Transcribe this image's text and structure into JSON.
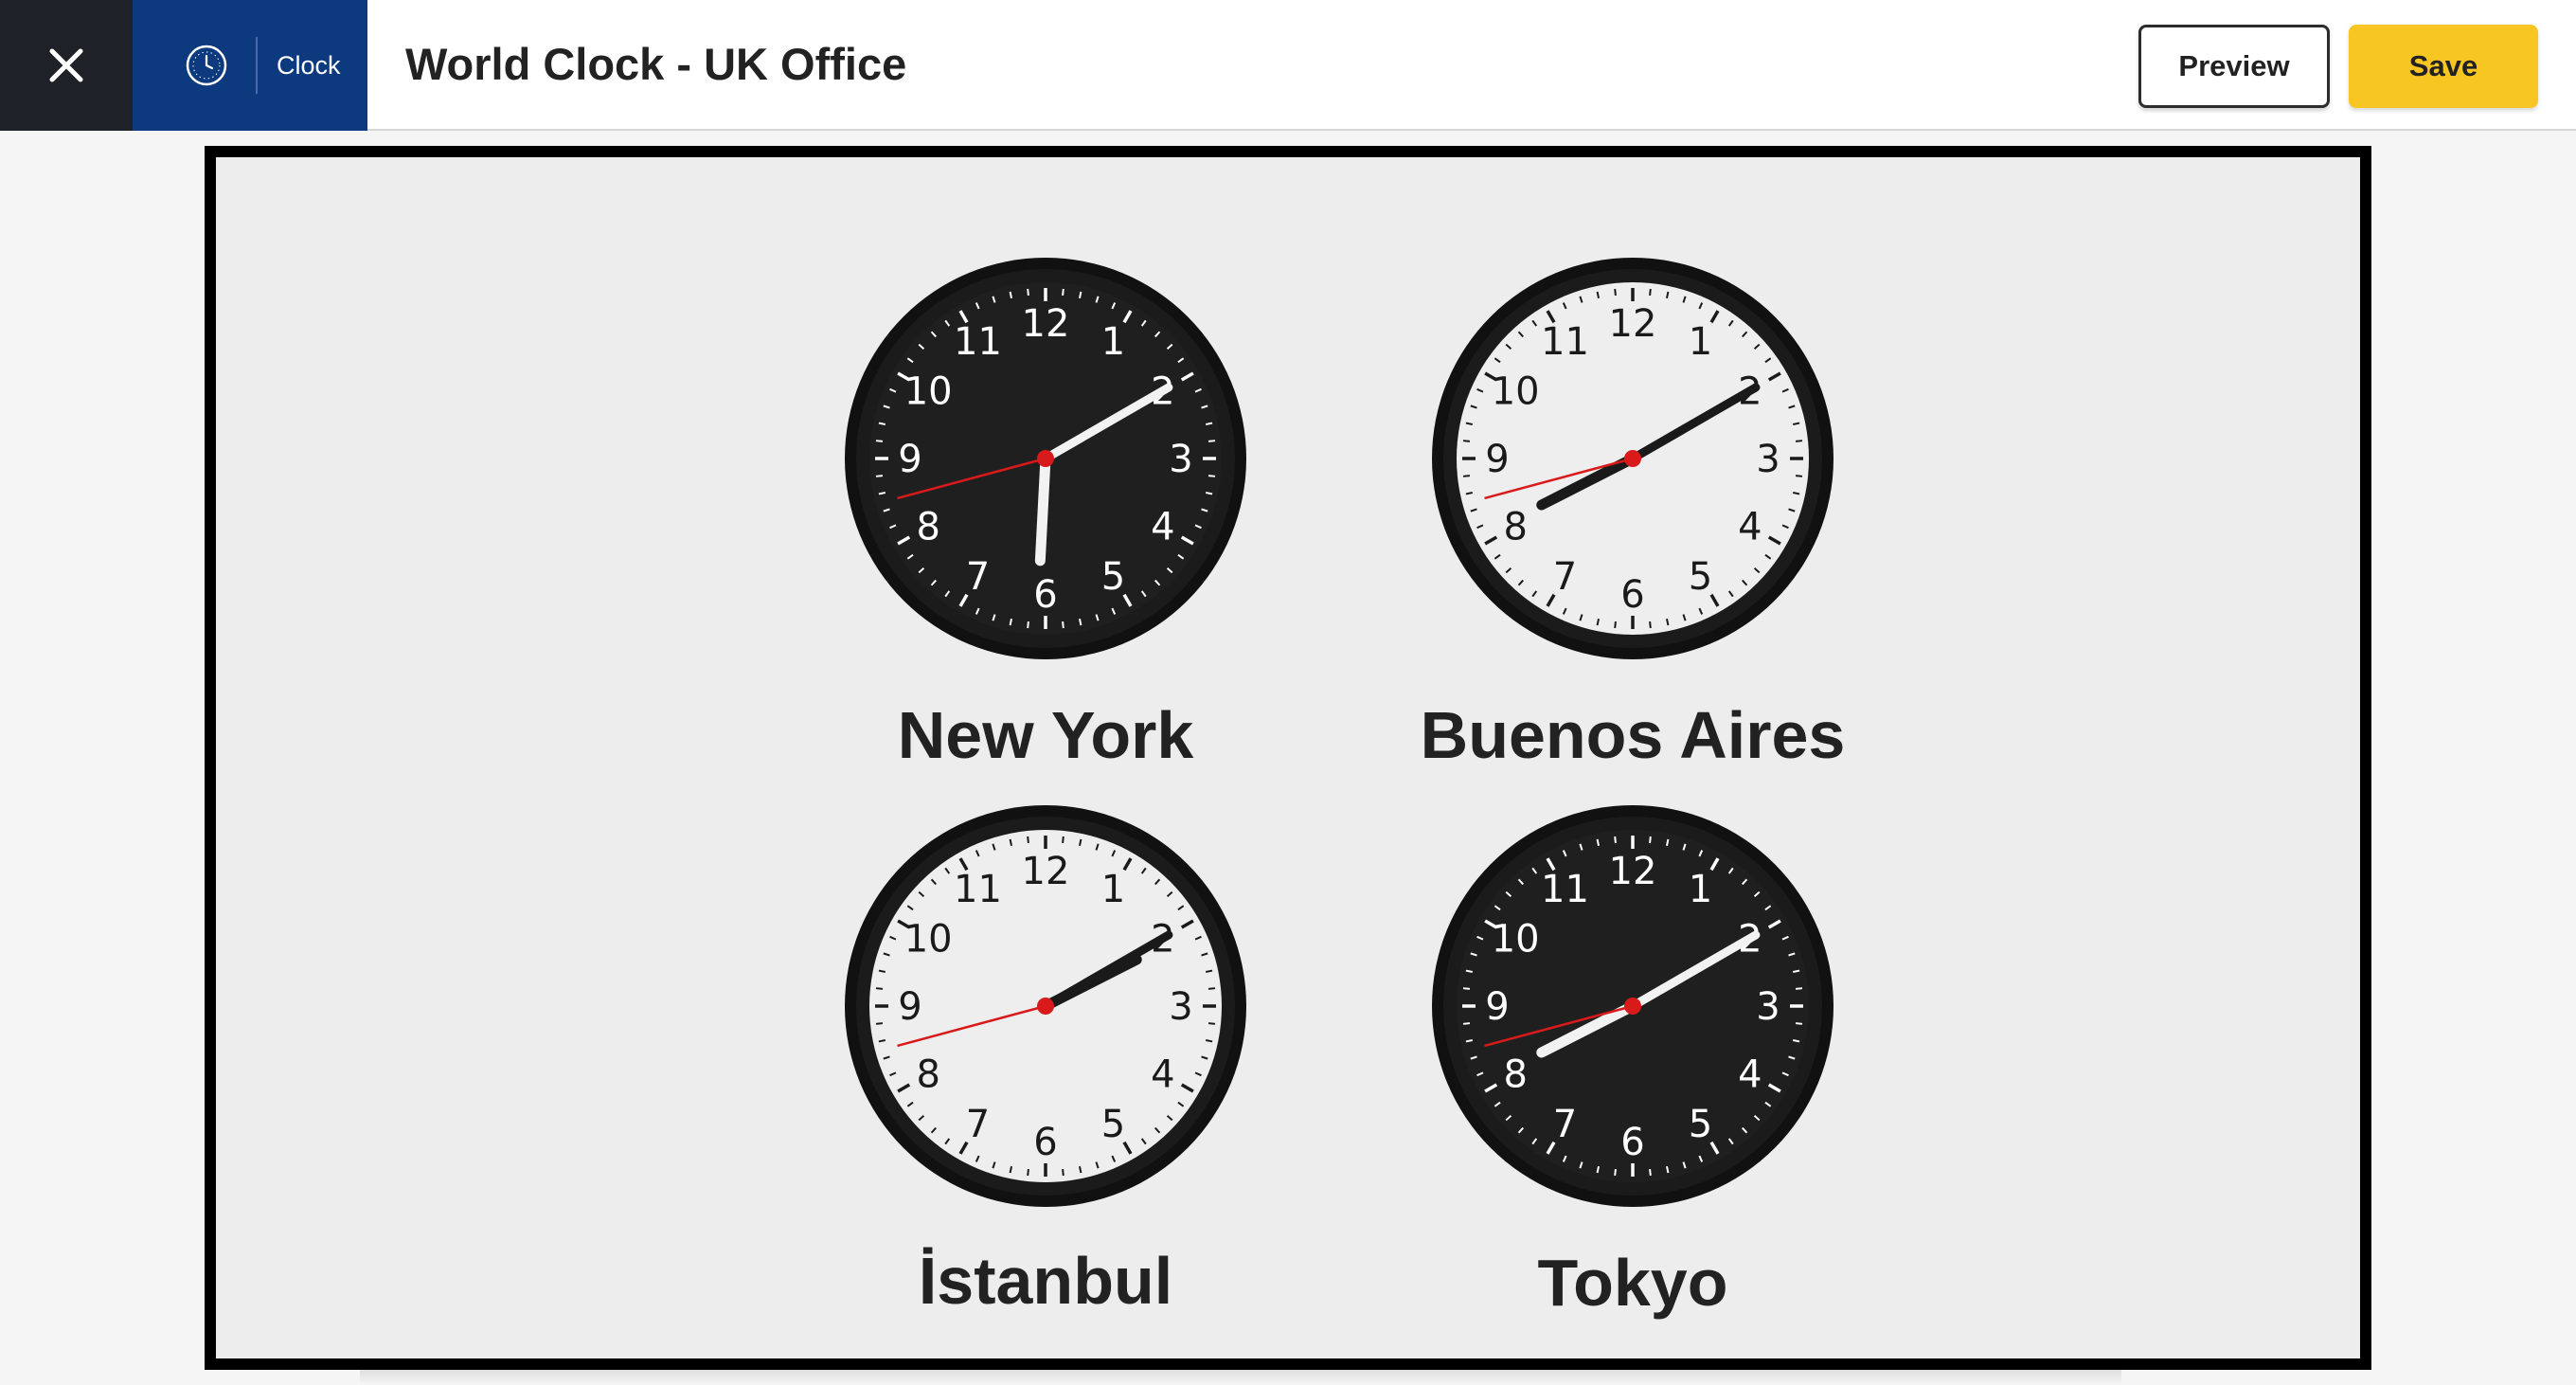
{
  "header": {
    "close_icon": "close-icon",
    "app_icon": "clock-icon",
    "app_label": "Clock",
    "title": "World Clock - UK Office",
    "preview_label": "Preview",
    "save_label": "Save",
    "colors": {
      "app_badge": "#0d3a7e",
      "save_button": "#f7c623",
      "close_area": "#1e2228"
    }
  },
  "clocks": [
    {
      "city": "New York",
      "theme": "dark",
      "hour_hand_clock_position": 6.1,
      "minute_hand_clock_position": 2.0,
      "second_hand_clock_position": 8.5
    },
    {
      "city": "Buenos Aires",
      "theme": "light",
      "hour_hand_clock_position": 8.1,
      "minute_hand_clock_position": 2.0,
      "second_hand_clock_position": 8.5
    },
    {
      "city": "İstanbul",
      "theme": "light",
      "hour_hand_clock_position": 2.1,
      "minute_hand_clock_position": 2.0,
      "second_hand_clock_position": 8.5
    },
    {
      "city": "Tokyo",
      "theme": "dark",
      "hour_hand_clock_position": 8.1,
      "minute_hand_clock_position": 2.0,
      "second_hand_clock_position": 8.5
    }
  ],
  "clock_numerals": [
    "12",
    "1",
    "2",
    "3",
    "4",
    "5",
    "6",
    "7",
    "8",
    "9",
    "10",
    "11"
  ]
}
